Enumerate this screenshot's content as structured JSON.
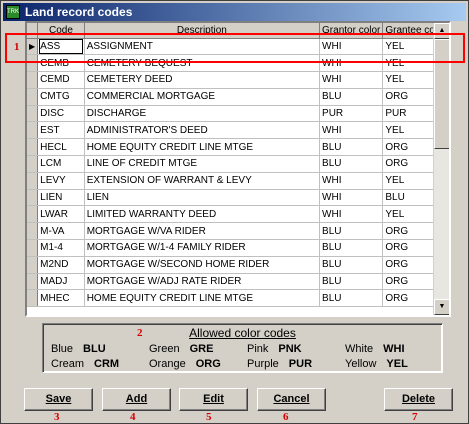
{
  "window": {
    "title": "Land record codes",
    "app_icon": "TRK"
  },
  "grid": {
    "columns": [
      "Code",
      "Description",
      "Grantor color",
      "Grantee color"
    ],
    "rows": [
      {
        "code": "ASS",
        "description": "ASSIGNMENT",
        "grantor": "WHI",
        "grantee": "YEL"
      },
      {
        "code": "CEMB",
        "description": "CEMETERY BEQUEST",
        "grantor": "WHI",
        "grantee": "YEL"
      },
      {
        "code": "CEMD",
        "description": "CEMETERY DEED",
        "grantor": "WHI",
        "grantee": "YEL"
      },
      {
        "code": "CMTG",
        "description": "COMMERCIAL MORTGAGE",
        "grantor": "BLU",
        "grantee": "ORG"
      },
      {
        "code": "DISC",
        "description": "DISCHARGE",
        "grantor": "PUR",
        "grantee": "PUR"
      },
      {
        "code": "EST",
        "description": "ADMINISTRATOR'S DEED",
        "grantor": "WHI",
        "grantee": "YEL"
      },
      {
        "code": "HECL",
        "description": "HOME EQUITY CREDIT LINE MTGE",
        "grantor": "BLU",
        "grantee": "ORG"
      },
      {
        "code": "LCM",
        "description": "LINE OF CREDIT MTGE",
        "grantor": "BLU",
        "grantee": "ORG"
      },
      {
        "code": "LEVY",
        "description": "EXTENSION OF WARRANT & LEVY",
        "grantor": "WHI",
        "grantee": "YEL"
      },
      {
        "code": "LIEN",
        "description": "LIEN",
        "grantor": "WHI",
        "grantee": "BLU"
      },
      {
        "code": "LWAR",
        "description": "LIMITED WARRANTY DEED",
        "grantor": "WHI",
        "grantee": "YEL"
      },
      {
        "code": "M-VA",
        "description": "MORTGAGE W/VA RIDER",
        "grantor": "BLU",
        "grantee": "ORG"
      },
      {
        "code": "M1-4",
        "description": "MORTGAGE W/1-4 FAMILY RIDER",
        "grantor": "BLU",
        "grantee": "ORG"
      },
      {
        "code": "M2ND",
        "description": "MORTGAGE W/SECOND HOME RIDER",
        "grantor": "BLU",
        "grantee": "ORG"
      },
      {
        "code": "MADJ",
        "description": "MORTGAGE W/ADJ RATE RIDER",
        "grantor": "BLU",
        "grantee": "ORG"
      },
      {
        "code": "MHEC",
        "description": "HOME EQUITY CREDIT LINE MTGE",
        "grantor": "BLU",
        "grantee": "ORG"
      }
    ]
  },
  "allowed_colors": {
    "title": "Allowed color codes",
    "items": [
      {
        "name": "Blue",
        "code": "BLU"
      },
      {
        "name": "Green",
        "code": "GRE"
      },
      {
        "name": "Pink",
        "code": "PNK"
      },
      {
        "name": "White",
        "code": "WHI"
      },
      {
        "name": "Cream",
        "code": "CRM"
      },
      {
        "name": "Orange",
        "code": "ORG"
      },
      {
        "name": "Purple",
        "code": "PUR"
      },
      {
        "name": "Yellow",
        "code": "YEL"
      }
    ]
  },
  "buttons": {
    "save": "Save",
    "add": "Add",
    "edit": "Edit",
    "cancel": "Cancel",
    "delete": "Delete"
  },
  "markers": [
    "1",
    "2",
    "3",
    "4",
    "5",
    "6",
    "7"
  ]
}
